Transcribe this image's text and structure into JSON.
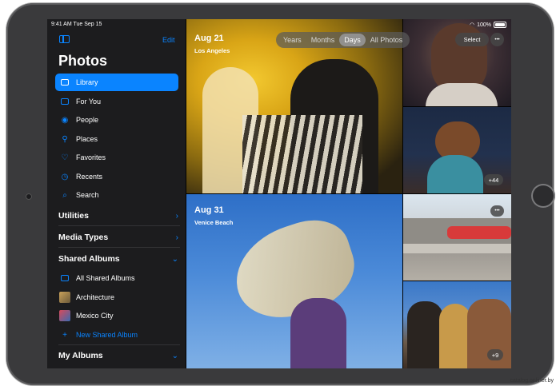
{
  "status_bar": {
    "time_date": "9:41 AM  Tue Sep 15",
    "battery": "100%"
  },
  "sidebar": {
    "edit_label": "Edit",
    "title": "Photos",
    "items": [
      {
        "label": "Library",
        "icon": "library-icon"
      },
      {
        "label": "For You",
        "icon": "for-you-icon"
      },
      {
        "label": "People",
        "icon": "people-icon"
      },
      {
        "label": "Places",
        "icon": "places-icon"
      },
      {
        "label": "Favorites",
        "icon": "heart-icon"
      },
      {
        "label": "Recents",
        "icon": "clock-icon"
      },
      {
        "label": "Search",
        "icon": "search-icon"
      }
    ],
    "sections": {
      "utilities": "Utilities",
      "media_types": "Media Types",
      "shared_albums": "Shared Albums",
      "my_albums": "My Albums"
    },
    "shared_items": [
      {
        "label": "All Shared Albums"
      },
      {
        "label": "Architecture"
      },
      {
        "label": "Mexico City"
      }
    ],
    "new_shared_album": "New Shared Album"
  },
  "toolbar": {
    "segments": [
      "Years",
      "Months",
      "Days",
      "All Photos"
    ],
    "selected_segment": "Days",
    "select_label": "Select",
    "more_label": "•••"
  },
  "groups": [
    {
      "date": "Aug 21",
      "place": "Los Angeles",
      "more_count": "+44"
    },
    {
      "date": "Aug 31",
      "place": "Venice Beach",
      "more_count": "+9"
    }
  ],
  "watermark": "catalog.onliner.by",
  "colors": {
    "accent": "#0a84ff",
    "sidebar_bg": "#1c1c1e"
  }
}
